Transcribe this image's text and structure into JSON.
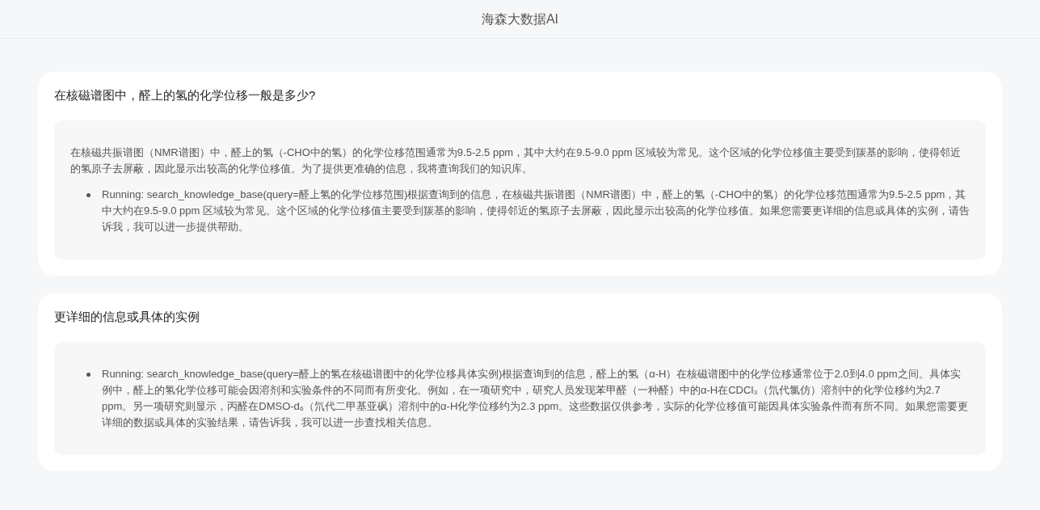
{
  "header": {
    "title": "海森大数据AI"
  },
  "messages": [
    {
      "question": "在核磁谱图中，醛上的氢的化学位移一般是多少?",
      "answer": {
        "paragraphs": [
          "在核磁共振谱图（NMR谱图）中，醛上的氢（-CHO中的氢）的化学位移范围通常为9.5-2.5 ppm，其中大约在9.5-9.0 ppm 区域较为常见。这个区域的化学位移值主要受到羰基的影响，使得邻近的氢原子去屏蔽，因此显示出较高的化学位移值。为了提供更准确的信息，我将查询我们的知识库。"
        ],
        "bullets": [
          "Running: search_knowledge_base(query=醛上氢的化学位移范围)根据查询到的信息，在核磁共振谱图（NMR谱图）中，醛上的氢（-CHO中的氢）的化学位移范围通常为9.5-2.5 ppm，其中大约在9.5-9.0 ppm 区域较为常见。这个区域的化学位移值主要受到羰基的影响，使得邻近的氢原子去屏蔽，因此显示出较高的化学位移值。如果您需要更详细的信息或具体的实例，请告诉我，我可以进一步提供帮助。"
        ]
      }
    },
    {
      "question": "更详细的信息或具体的实例",
      "answer": {
        "bullets": [
          "Running: search_knowledge_base(query=醛上的氢在核磁谱图中的化学位移具体实例)根据查询到的信息，醛上的氢（α-H）在核磁谱图中的化学位移通常位于2.0到4.0 ppm之间。具体实例中，醛上的氢化学位移可能会因溶剂和实验条件的不同而有所变化。例如，在一项研究中，研究人员发现苯甲醛（一种醛）中的α-H在CDCl₃（氘代氯仿）溶剂中的化学位移约为2.7 ppm。另一项研究则显示，丙醛在DMSO-d₆（氘代二甲基亚砜）溶剂中的α-H化学位移约为2.3 ppm。这些数据仅供参考，实际的化学位移值可能因具体实验条件而有所不同。如果您需要更详细的数据或具体的实验结果，请告诉我，我可以进一步查找相关信息。"
        ]
      }
    }
  ]
}
